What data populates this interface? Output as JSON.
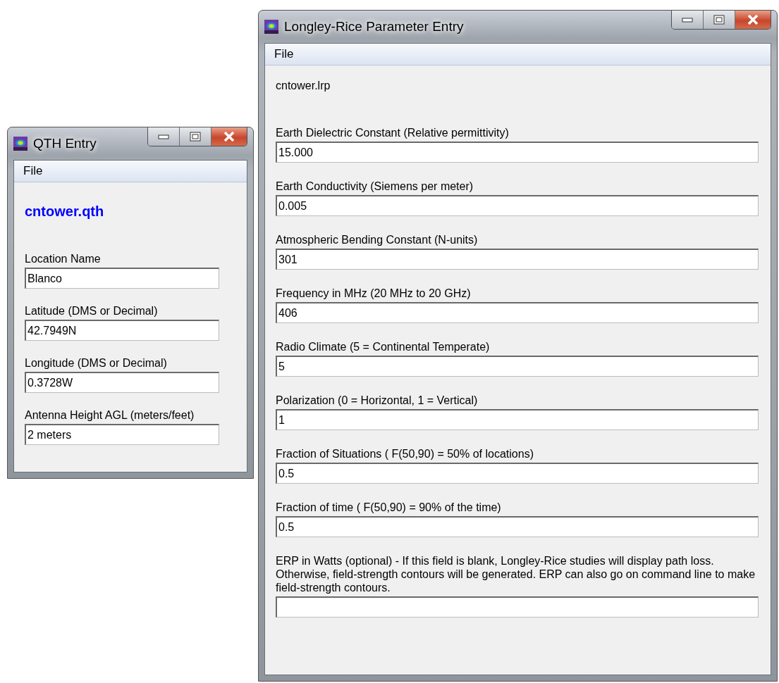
{
  "windows": [
    {
      "kind": "qth",
      "title": "QTH Entry",
      "menu": [
        "File"
      ],
      "filename": "cntower.qth",
      "fields": [
        {
          "label": "Location Name",
          "value": "Blanco"
        },
        {
          "label": "Latitude (DMS or Decimal)",
          "value": "42.7949N"
        },
        {
          "label": "Longitude (DMS or Decimal)",
          "value": "0.3728W"
        },
        {
          "label": "Antenna Height AGL (meters/feet)",
          "value": "2 meters"
        }
      ]
    },
    {
      "kind": "lrp",
      "title": "Longley-Rice Parameter Entry",
      "menu": [
        "File"
      ],
      "filename": "cntower.lrp",
      "fields": [
        {
          "label": "Earth Dielectric Constant (Relative permittivity)",
          "value": "15.000"
        },
        {
          "label": "Earth Conductivity (Siemens per meter)",
          "value": "0.005"
        },
        {
          "label": "Atmospheric Bending Constant (N-units)",
          "value": "301"
        },
        {
          "label": "Frequency in MHz (20 MHz to 20 GHz)",
          "value": "406"
        },
        {
          "label": "Radio Climate (5 = Continental Temperate)",
          "value": "5"
        },
        {
          "label": "Polarization (0 = Horizontal, 1 = Vertical)",
          "value": "1"
        },
        {
          "label": "Fraction of Situations ( F(50,90) = 50% of locations)",
          "value": "0.5"
        },
        {
          "label": "Fraction of time ( F(50,90) = 90% of the time)",
          "value": "0.5"
        },
        {
          "label": "ERP in Watts (optional) - If this field is blank, Longley-Rice studies will display path loss. Otherwise, field-strength contours will be generated. ERP can also go on command line to make field-strength contours."
        }
      ]
    }
  ]
}
